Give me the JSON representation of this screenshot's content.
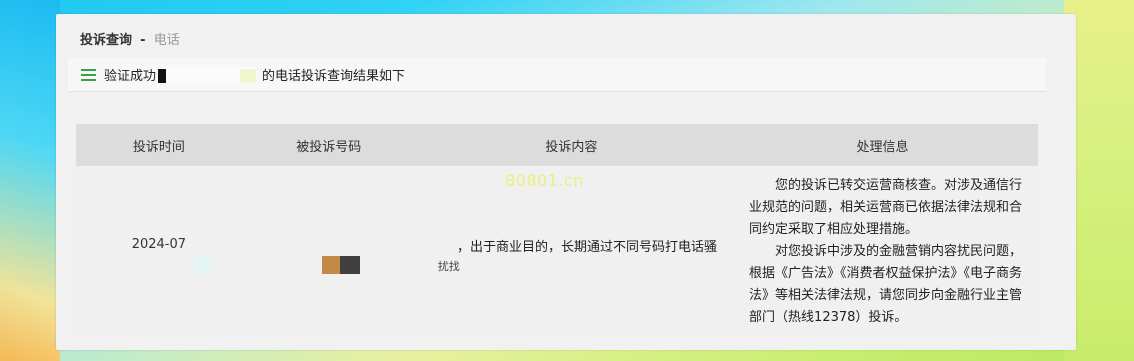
{
  "header": {
    "title": "投诉查询",
    "separator": "-",
    "subtitle": "电话"
  },
  "notice": {
    "prefix": "验证成功",
    "suffix": "的电话投诉查询结果如下"
  },
  "table": {
    "columns": [
      "投诉时间",
      "被投诉号码",
      "投诉内容",
      "处理信息"
    ],
    "rows": [
      {
        "time": "2024-07",
        "content": "，出于商业目的，长期通过不同号码打电话骚",
        "content_tail": "扰找",
        "info_p1": "您的投诉已转交运营商核查。对涉及通信行业规范的问题，相关运营商已依据法律法规和合同约定采取了相应处理措施。",
        "info_p2": "对您投诉中涉及的金融营销内容扰民问题，根据《广告法》《消费者权益保护法》《电子商务法》等相关法律法规，请您同步向金融行业主管部门（热线12378）投诉。"
      }
    ]
  },
  "watermark": "80801.cn",
  "colors": {
    "icon_green": "#3aa146",
    "header_bg": "#dcdcdc",
    "panel_bg": "#f1f1f1"
  },
  "icons": {
    "notice_icon": "menu-list-icon"
  }
}
